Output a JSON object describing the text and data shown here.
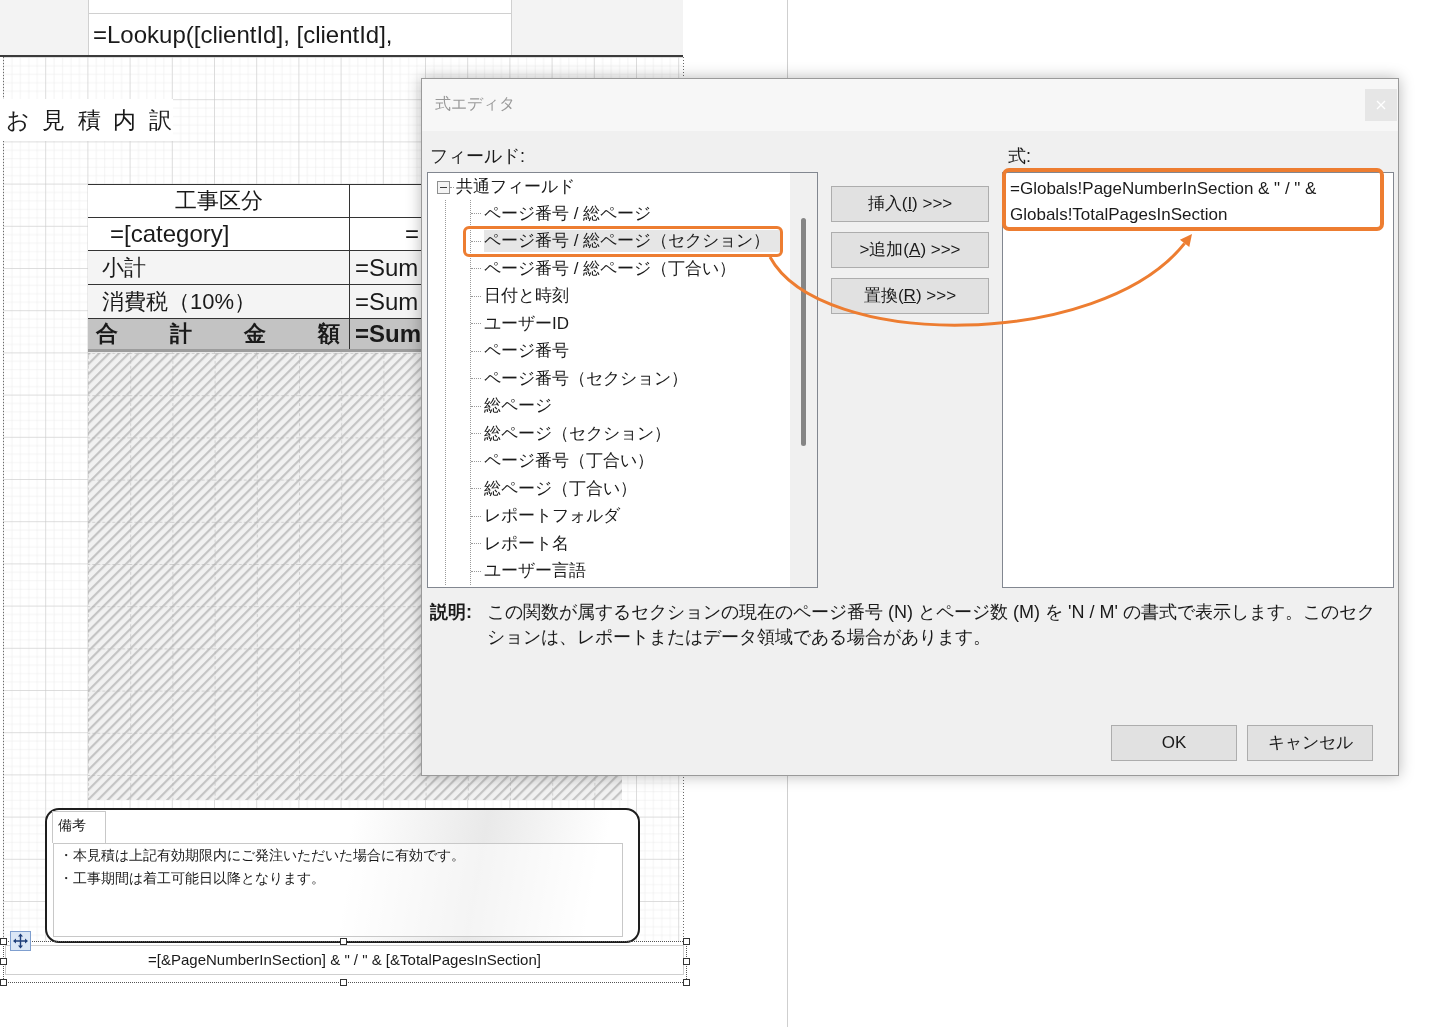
{
  "report": {
    "lookup_cell": "=Lookup([clientId], [clientId],",
    "title": "お 見 積 内 訳",
    "table": {
      "rows": [
        {
          "kind": "header",
          "cells": [
            "工事区分"
          ]
        },
        {
          "kind": "detail",
          "cells": [
            "=[category]",
            "="
          ]
        },
        {
          "kind": "summary",
          "cells": [
            "小計",
            "=Sum"
          ]
        },
        {
          "kind": "summary",
          "cells": [
            "消費税（10%）",
            "=Sum"
          ]
        },
        {
          "kind": "total",
          "cells": [
            "合 計 金 額",
            "=Sum"
          ]
        }
      ]
    },
    "remarks": {
      "label": "備考",
      "lines": [
        "・本見積は上記有効期限内にご発注いただいた場合に有効です。",
        "・工事期間は着工可能日以降となります。"
      ]
    },
    "footer_expression": "=[&PageNumberInSection] & \" / \" & [&TotalPagesInSection]"
  },
  "dialog": {
    "title": "式エディタ",
    "fields_label": "フィールド:",
    "tree": [
      {
        "label": "共通フィールド",
        "expanded": true,
        "children": [
          {
            "label": "ページ番号 / 総ページ",
            "selected": false
          },
          {
            "label": "ページ番号 / 総ページ（セクション）",
            "selected": true
          },
          {
            "label": "ページ番号 / 総ページ（丁合い）",
            "selected": false
          },
          {
            "label": "日付と時刻",
            "selected": false
          },
          {
            "label": "ユーザーID",
            "selected": false
          },
          {
            "label": "ページ番号",
            "selected": false
          },
          {
            "label": "ページ番号（セクション）",
            "selected": false
          },
          {
            "label": "総ページ",
            "selected": false
          },
          {
            "label": "総ページ（セクション）",
            "selected": false
          },
          {
            "label": "ページ番号（丁合い）",
            "selected": false
          },
          {
            "label": "総ページ（丁合い）",
            "selected": false
          },
          {
            "label": "レポートフォルダ",
            "selected": false
          },
          {
            "label": "レポート名",
            "selected": false
          },
          {
            "label": "ユーザー言語",
            "selected": false
          }
        ]
      }
    ],
    "actions": [
      {
        "before": "挿入(",
        "key": "I",
        "after": ") >>>"
      },
      {
        "before": ">追加(",
        "key": "A",
        "after": ") >>>"
      },
      {
        "before": "置換(",
        "key": "R",
        "after": ") >>>"
      }
    ],
    "expression_label": "式:",
    "expression": "=Globals!PageNumberInSection & \" / \" & Globals!TotalPagesInSection",
    "description_label": "説明:",
    "description": "この関数が属するセクションの現在のページ番号 (N) とページ数 (M) を 'N / M' の書式で表示します。このセクションは、レポートまたはデータ領域である場合があります。",
    "buttons": [
      "OK",
      "キャンセル"
    ]
  }
}
